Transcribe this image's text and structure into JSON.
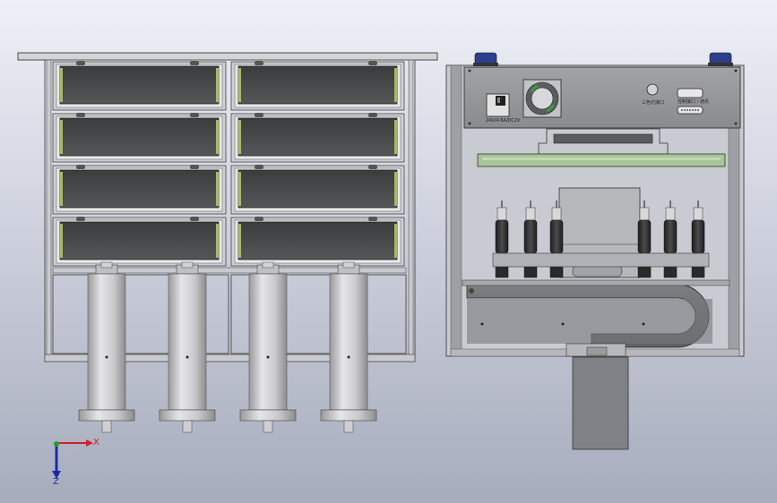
{
  "viewport": {
    "background_top": "#eef0f7",
    "background_bottom": "#a7acbd"
  },
  "left_view": {
    "tray_rows": 4,
    "tray_cols": 2,
    "cylinder_count": 4,
    "frame_color": "#6f7073",
    "tray_color": "#4a4b4c"
  },
  "right_view": {
    "panel_labels": {
      "power": "24V/4.6A/DC2V",
      "indicator": "三色灯接口",
      "port": "控制接口 / 通讯"
    },
    "nozzle_count": 6,
    "pcb_color": "#a8c49a",
    "caps_color": "#2d3f8c"
  },
  "triad": {
    "x_label": "X",
    "z_label": "Z",
    "x_color": "#d0202a",
    "z_color": "#1b2aa8"
  }
}
